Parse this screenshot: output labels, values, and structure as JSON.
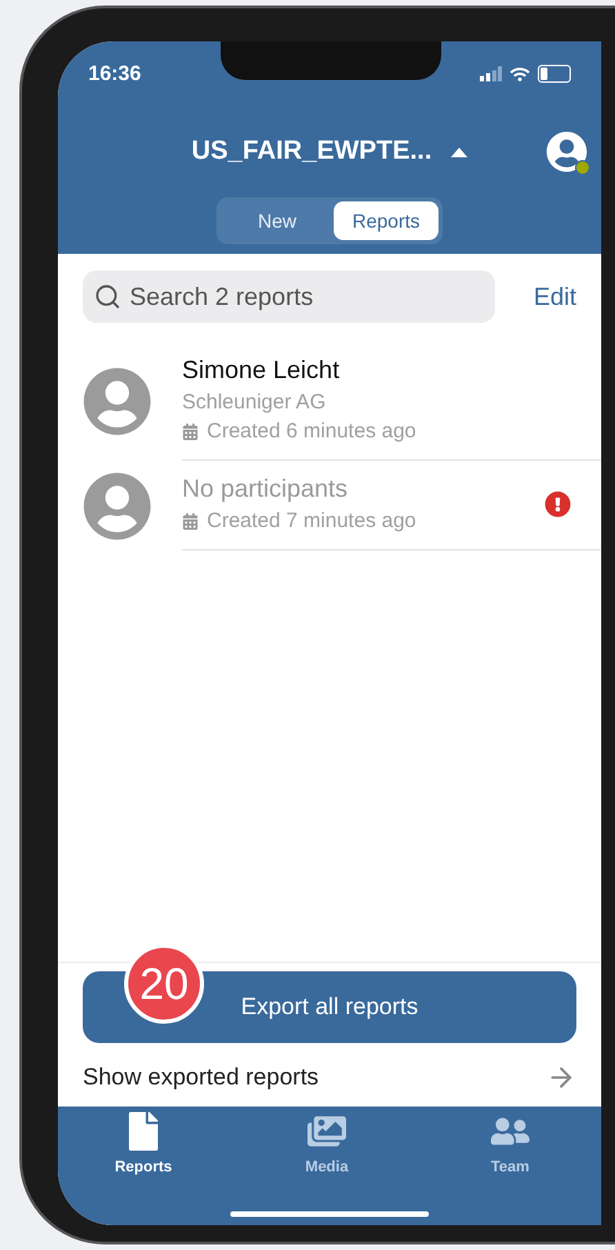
{
  "status_bar": {
    "time": "16:36"
  },
  "header": {
    "title": "US_FAIR_EWPTE...",
    "tabs": [
      {
        "label": "New",
        "selected": false
      },
      {
        "label": "Reports",
        "selected": true
      }
    ]
  },
  "search": {
    "placeholder": "Search 2 reports"
  },
  "edit_link": "Edit",
  "reports": [
    {
      "title": "Simone Leicht",
      "has_participants": true,
      "company": "Schleuniger AG",
      "created": "Created 6 minutes ago",
      "warning": false
    },
    {
      "title": "No participants",
      "has_participants": false,
      "created": "Created 7 minutes ago",
      "warning": true
    }
  ],
  "export_button": {
    "label": "Export all reports",
    "step_badge": "20"
  },
  "exported_link": "Show exported reports",
  "tab_bar": [
    {
      "label": "Reports",
      "kind": "file",
      "selected": true
    },
    {
      "label": "Media",
      "kind": "images",
      "selected": false
    },
    {
      "label": "Team",
      "kind": "users",
      "selected": false
    }
  ]
}
